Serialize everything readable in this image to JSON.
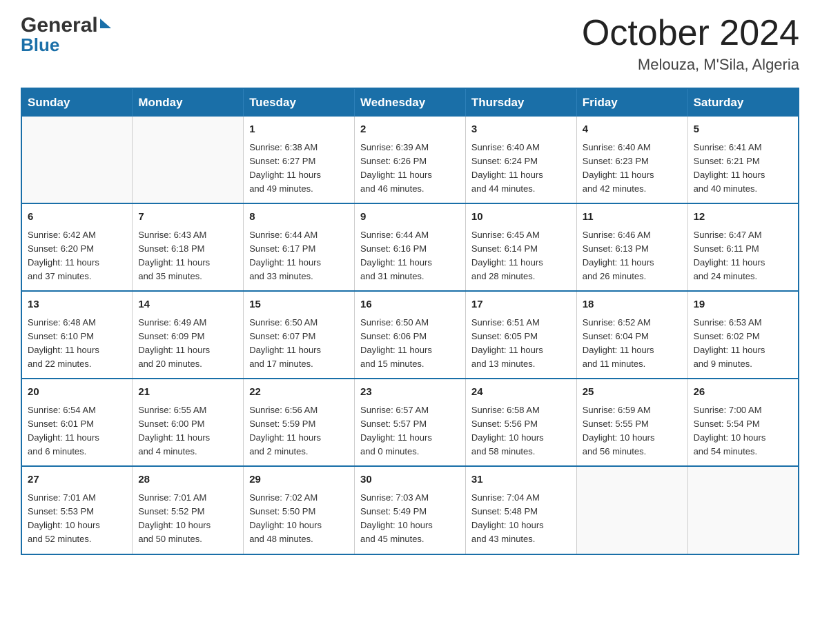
{
  "header": {
    "logo_general": "General",
    "logo_blue": "Blue",
    "month_title": "October 2024",
    "location": "Melouza, M'Sila, Algeria"
  },
  "calendar": {
    "days_of_week": [
      "Sunday",
      "Monday",
      "Tuesday",
      "Wednesday",
      "Thursday",
      "Friday",
      "Saturday"
    ],
    "weeks": [
      [
        {
          "day": "",
          "info": ""
        },
        {
          "day": "",
          "info": ""
        },
        {
          "day": "1",
          "info": "Sunrise: 6:38 AM\nSunset: 6:27 PM\nDaylight: 11 hours\nand 49 minutes."
        },
        {
          "day": "2",
          "info": "Sunrise: 6:39 AM\nSunset: 6:26 PM\nDaylight: 11 hours\nand 46 minutes."
        },
        {
          "day": "3",
          "info": "Sunrise: 6:40 AM\nSunset: 6:24 PM\nDaylight: 11 hours\nand 44 minutes."
        },
        {
          "day": "4",
          "info": "Sunrise: 6:40 AM\nSunset: 6:23 PM\nDaylight: 11 hours\nand 42 minutes."
        },
        {
          "day": "5",
          "info": "Sunrise: 6:41 AM\nSunset: 6:21 PM\nDaylight: 11 hours\nand 40 minutes."
        }
      ],
      [
        {
          "day": "6",
          "info": "Sunrise: 6:42 AM\nSunset: 6:20 PM\nDaylight: 11 hours\nand 37 minutes."
        },
        {
          "day": "7",
          "info": "Sunrise: 6:43 AM\nSunset: 6:18 PM\nDaylight: 11 hours\nand 35 minutes."
        },
        {
          "day": "8",
          "info": "Sunrise: 6:44 AM\nSunset: 6:17 PM\nDaylight: 11 hours\nand 33 minutes."
        },
        {
          "day": "9",
          "info": "Sunrise: 6:44 AM\nSunset: 6:16 PM\nDaylight: 11 hours\nand 31 minutes."
        },
        {
          "day": "10",
          "info": "Sunrise: 6:45 AM\nSunset: 6:14 PM\nDaylight: 11 hours\nand 28 minutes."
        },
        {
          "day": "11",
          "info": "Sunrise: 6:46 AM\nSunset: 6:13 PM\nDaylight: 11 hours\nand 26 minutes."
        },
        {
          "day": "12",
          "info": "Sunrise: 6:47 AM\nSunset: 6:11 PM\nDaylight: 11 hours\nand 24 minutes."
        }
      ],
      [
        {
          "day": "13",
          "info": "Sunrise: 6:48 AM\nSunset: 6:10 PM\nDaylight: 11 hours\nand 22 minutes."
        },
        {
          "day": "14",
          "info": "Sunrise: 6:49 AM\nSunset: 6:09 PM\nDaylight: 11 hours\nand 20 minutes."
        },
        {
          "day": "15",
          "info": "Sunrise: 6:50 AM\nSunset: 6:07 PM\nDaylight: 11 hours\nand 17 minutes."
        },
        {
          "day": "16",
          "info": "Sunrise: 6:50 AM\nSunset: 6:06 PM\nDaylight: 11 hours\nand 15 minutes."
        },
        {
          "day": "17",
          "info": "Sunrise: 6:51 AM\nSunset: 6:05 PM\nDaylight: 11 hours\nand 13 minutes."
        },
        {
          "day": "18",
          "info": "Sunrise: 6:52 AM\nSunset: 6:04 PM\nDaylight: 11 hours\nand 11 minutes."
        },
        {
          "day": "19",
          "info": "Sunrise: 6:53 AM\nSunset: 6:02 PM\nDaylight: 11 hours\nand 9 minutes."
        }
      ],
      [
        {
          "day": "20",
          "info": "Sunrise: 6:54 AM\nSunset: 6:01 PM\nDaylight: 11 hours\nand 6 minutes."
        },
        {
          "day": "21",
          "info": "Sunrise: 6:55 AM\nSunset: 6:00 PM\nDaylight: 11 hours\nand 4 minutes."
        },
        {
          "day": "22",
          "info": "Sunrise: 6:56 AM\nSunset: 5:59 PM\nDaylight: 11 hours\nand 2 minutes."
        },
        {
          "day": "23",
          "info": "Sunrise: 6:57 AM\nSunset: 5:57 PM\nDaylight: 11 hours\nand 0 minutes."
        },
        {
          "day": "24",
          "info": "Sunrise: 6:58 AM\nSunset: 5:56 PM\nDaylight: 10 hours\nand 58 minutes."
        },
        {
          "day": "25",
          "info": "Sunrise: 6:59 AM\nSunset: 5:55 PM\nDaylight: 10 hours\nand 56 minutes."
        },
        {
          "day": "26",
          "info": "Sunrise: 7:00 AM\nSunset: 5:54 PM\nDaylight: 10 hours\nand 54 minutes."
        }
      ],
      [
        {
          "day": "27",
          "info": "Sunrise: 7:01 AM\nSunset: 5:53 PM\nDaylight: 10 hours\nand 52 minutes."
        },
        {
          "day": "28",
          "info": "Sunrise: 7:01 AM\nSunset: 5:52 PM\nDaylight: 10 hours\nand 50 minutes."
        },
        {
          "day": "29",
          "info": "Sunrise: 7:02 AM\nSunset: 5:50 PM\nDaylight: 10 hours\nand 48 minutes."
        },
        {
          "day": "30",
          "info": "Sunrise: 7:03 AM\nSunset: 5:49 PM\nDaylight: 10 hours\nand 45 minutes."
        },
        {
          "day": "31",
          "info": "Sunrise: 7:04 AM\nSunset: 5:48 PM\nDaylight: 10 hours\nand 43 minutes."
        },
        {
          "day": "",
          "info": ""
        },
        {
          "day": "",
          "info": ""
        }
      ]
    ]
  }
}
